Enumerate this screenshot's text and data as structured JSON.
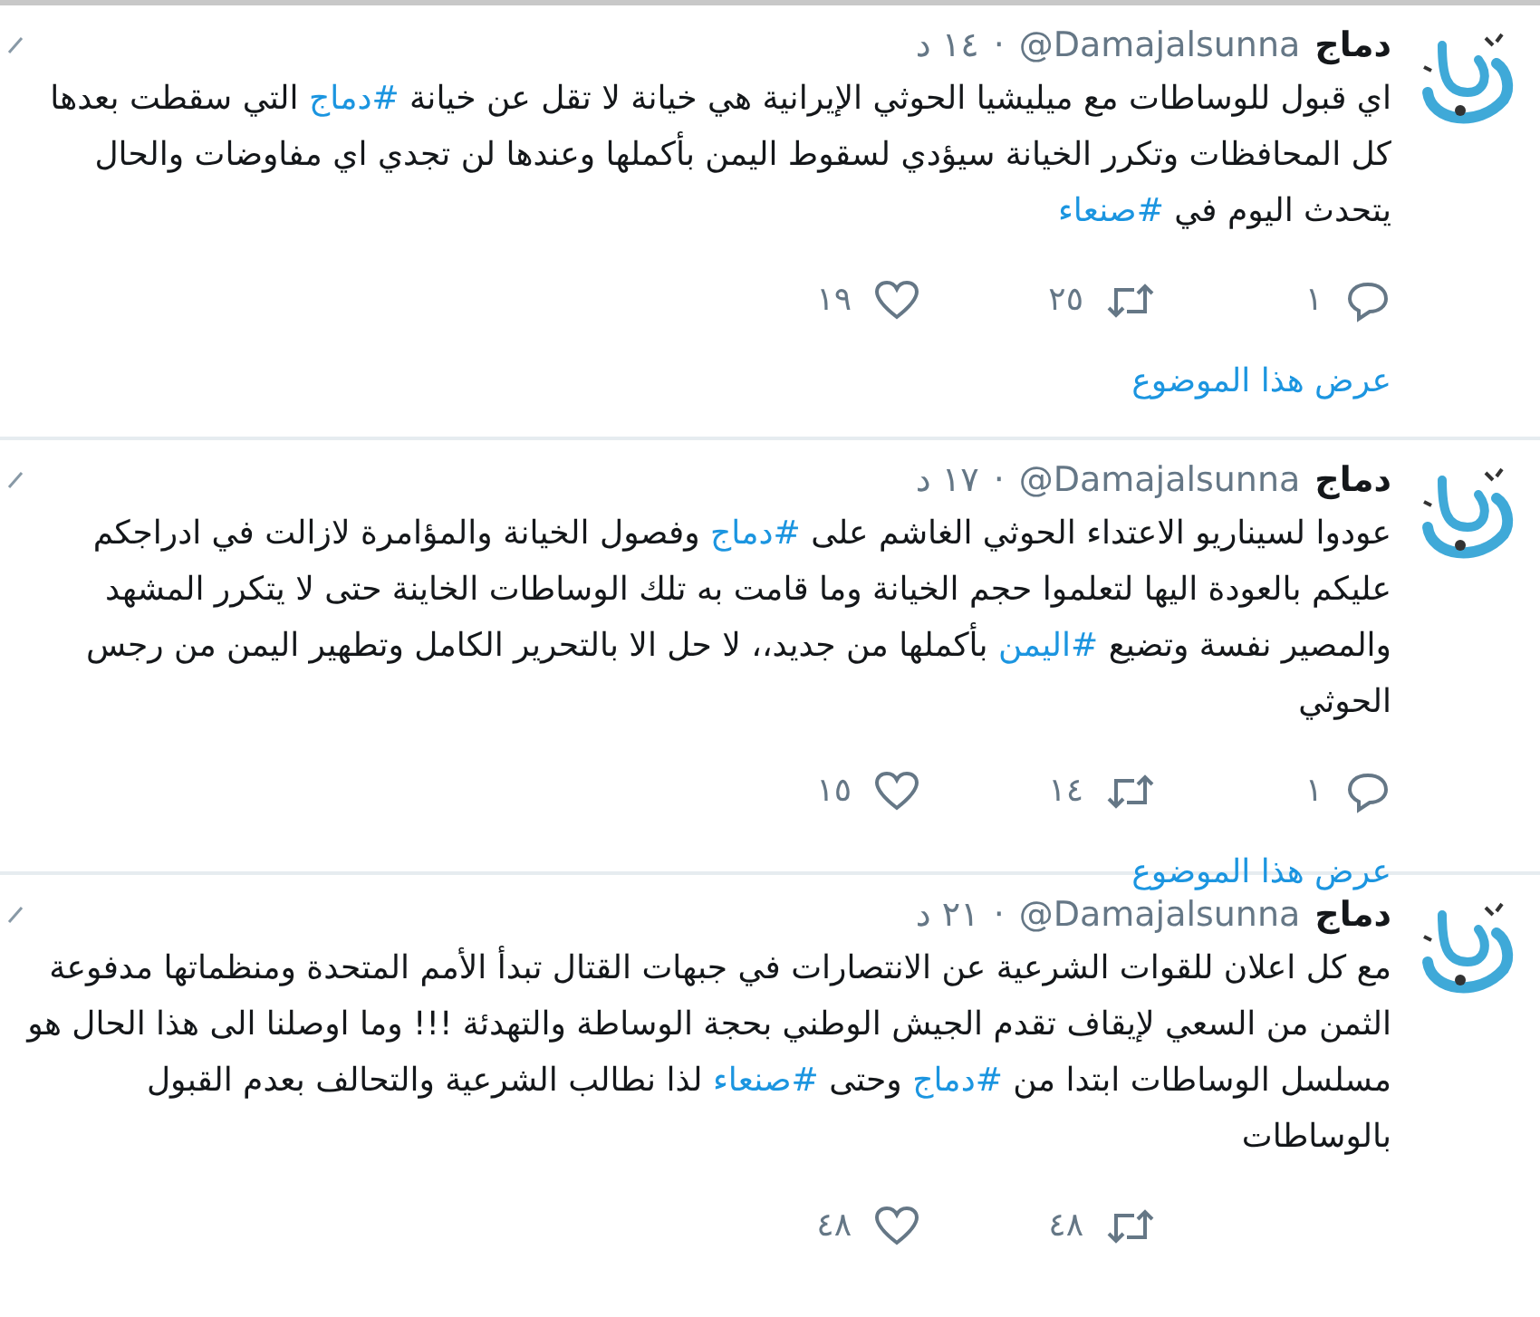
{
  "tweets": [
    {
      "name": "دماج",
      "handle": "@Damajalsunna",
      "separator": "·",
      "time": "١٤ د",
      "body": [
        {
          "kind": "text",
          "text": "اي قبول للوساطات مع ميليشيا الحوثي الإيرانية هي خيانة لا تقل عن خيانة "
        },
        {
          "kind": "hashtag",
          "text": "#دماج"
        },
        {
          "kind": "text",
          "text": " التي سقطت بعدها كل المحافظات وتكرر الخيانة سيؤدي لسقوط اليمن بأكملها وعندها لن تجدي اي مفاوضات والحال يتحدث اليوم في "
        },
        {
          "kind": "hashtag",
          "text": "#صنعاء"
        }
      ],
      "actions": [
        {
          "kind": "reply",
          "count": "١"
        },
        {
          "kind": "retweet",
          "count": "٢٥"
        },
        {
          "kind": "like",
          "count": "١٩"
        }
      ],
      "thread_link": "عرض هذا الموضوع"
    },
    {
      "name": "دماج",
      "handle": "@Damajalsunna",
      "separator": "·",
      "time": "١٧ د",
      "body": [
        {
          "kind": "text",
          "text": "عودوا لسيناريو الاعتداء الحوثي الغاشم على "
        },
        {
          "kind": "hashtag",
          "text": "#دماج"
        },
        {
          "kind": "text",
          "text": " وفصول الخيانة والمؤامرة لازالت في ادراجكم عليكم بالعودة اليها لتعلموا حجم الخيانة وما قامت به تلك الوساطات الخاينة حتى لا يتكرر المشهد والمصير نفسة وتضيع "
        },
        {
          "kind": "hashtag",
          "text": "#اليمن"
        },
        {
          "kind": "text",
          "text": " بأكملها من جديد،، لا حل الا بالتحرير الكامل وتطهير اليمن من رجس الحوثي"
        }
      ],
      "actions": [
        {
          "kind": "reply",
          "count": "١"
        },
        {
          "kind": "retweet",
          "count": "١٤"
        },
        {
          "kind": "like",
          "count": "١٥"
        }
      ],
      "thread_link": "عرض هذا الموضوع"
    },
    {
      "name": "دماج",
      "handle": "@Damajalsunna",
      "separator": "·",
      "time": "٢١ د",
      "body": [
        {
          "kind": "text",
          "text": "مع كل اعلان للقوات الشرعية عن الانتصارات في جبهات القتال تبدأ الأمم المتحدة ومنظماتها مدفوعة الثمن من السعي لإيقاف تقدم الجيش الوطني بحجة الوساطة والتهدئة !!! وما اوصلنا الى هذا الحال هو مسلسل الوساطات ابتدا من "
        },
        {
          "kind": "hashtag",
          "text": "#دماج"
        },
        {
          "kind": "text",
          "text": " وحتى "
        },
        {
          "kind": "hashtag",
          "text": "#صنعاء"
        },
        {
          "kind": "text",
          "text": " لذا نطالب الشرعية والتحالف بعدم القبول بالوساطات"
        }
      ],
      "actions": [
        {
          "kind": "retweet",
          "count": "٤٨"
        },
        {
          "kind": "like",
          "count": "٤٨"
        }
      ]
    }
  ]
}
